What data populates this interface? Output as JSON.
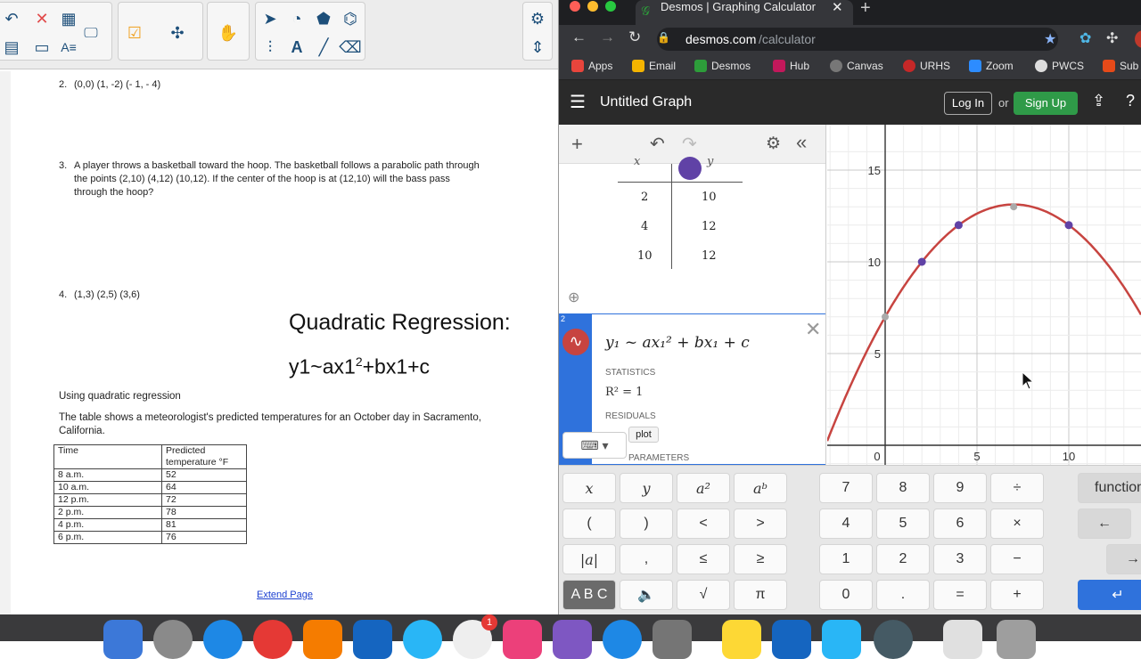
{
  "doc": {
    "toolbar": {
      "buttons": [
        "undo-icon",
        "close-icon",
        "table-icon",
        "screen-icon",
        "check-icon",
        "puzzle-icon",
        "hand-icon",
        "pointer-icon",
        "shapes-icon",
        "fill-icon",
        "text-icon",
        "line-icon",
        "eraser-icon",
        "settings-icon",
        "expand-icon"
      ]
    },
    "questions": [
      {
        "num": "2.",
        "lines": [
          "(0,0) (1, -2) (- 1, - 4)"
        ]
      },
      {
        "num": "3.",
        "lines": [
          "A player throws a basketball toward the hoop. The basketball follows a parabolic path through",
          "the points (2,10) (4,12) (10,12). If the center of the hoop is at (12,10) will the bass pass",
          "through the hoop?"
        ]
      },
      {
        "num": "4.",
        "lines": [
          "(1,3) (2,5) (3,6)"
        ]
      }
    ],
    "qr_title": "Quadratic Regression:",
    "qr_formula_pre": "y1~ax1",
    "qr_formula_sup": "2",
    "qr_formula_post": "+bx1+c",
    "using_text": "Using quadratic regression",
    "table_intro": [
      "The table shows a meteorologist's predicted temperatures for an October day in Sacramento,",
      "California."
    ],
    "table": {
      "headers": [
        "Time",
        "Predicted temperature °F"
      ],
      "rows": [
        [
          "8 a.m.",
          "52"
        ],
        [
          "10 a.m.",
          "64"
        ],
        [
          "12 p.m.",
          "72"
        ],
        [
          "2 p.m.",
          "78"
        ],
        [
          "4 p.m.",
          "81"
        ],
        [
          "6 p.m.",
          "76"
        ]
      ]
    },
    "extend_link": "Extend Page"
  },
  "browser": {
    "tab_title": "Desmos | Graphing Calculator",
    "url_domain": "desmos.com",
    "url_path": "/calculator",
    "bookmarks": [
      {
        "label": "Apps",
        "color": "#e8453c"
      },
      {
        "label": "Email",
        "color": "#f4b400"
      },
      {
        "label": "Desmos",
        "color": "#2d9d3a"
      },
      {
        "label": "Hub",
        "color": "#c2185b"
      },
      {
        "label": "Canvas",
        "color": "#777777"
      },
      {
        "label": "URHS",
        "color": "#c62828"
      },
      {
        "label": "Zoom",
        "color": "#2d8cff"
      },
      {
        "label": "PWCS",
        "color": "#dddddd"
      },
      {
        "label": "Sub",
        "color": "#e64a19"
      }
    ]
  },
  "desmos": {
    "graph_title": "Untitled Graph",
    "login": "Log In",
    "or": "or",
    "signup": "Sign Up",
    "table": {
      "header_x": "x",
      "header_y": "y",
      "rows": [
        [
          "2",
          "10"
        ],
        [
          "4",
          "12"
        ],
        [
          "10",
          "12"
        ]
      ]
    },
    "expr_num": "2",
    "expression": "y₁ ~ ax₁² + bx₁ + c",
    "statistics_label": "STATISTICS",
    "r2": "R² = 1",
    "residuals_label": "RESIDUALS",
    "plot_label": "plot",
    "parameters_label": "PARAMETERS",
    "keys_left": [
      [
        "x",
        "y",
        "a²",
        "aᵇ"
      ],
      [
        "(",
        ")",
        "<",
        ">"
      ],
      [
        "|a|",
        ",",
        "≤",
        "≥"
      ],
      [
        "A B C",
        "🔈",
        "√",
        "π"
      ]
    ],
    "keys_num": [
      [
        "7",
        "8",
        "9",
        "÷"
      ],
      [
        "4",
        "5",
        "6",
        "×"
      ],
      [
        "1",
        "2",
        "3",
        "−"
      ],
      [
        "0",
        ".",
        "=",
        "+"
      ]
    ],
    "keys_right": [
      "functions",
      "←",
      "→",
      "↵"
    ]
  },
  "chart_data": {
    "type": "scatter",
    "x_ticks": [
      "0",
      "5",
      "10"
    ],
    "y_ticks": [
      "5",
      "10",
      "15"
    ],
    "xlim": [
      -3,
      14
    ],
    "ylim": [
      -1,
      16
    ],
    "grid": true,
    "points": [
      {
        "x": 2,
        "y": 10
      },
      {
        "x": 4,
        "y": 12
      },
      {
        "x": 10,
        "y": 12
      }
    ],
    "special_points": [
      {
        "x": 0,
        "y": 7
      },
      {
        "x": 7,
        "y": 13
      }
    ],
    "curve": {
      "a": -0.125,
      "b": 1.75,
      "c": 7
    },
    "curve_color": "#c74440",
    "point_color": "#6042a6"
  }
}
